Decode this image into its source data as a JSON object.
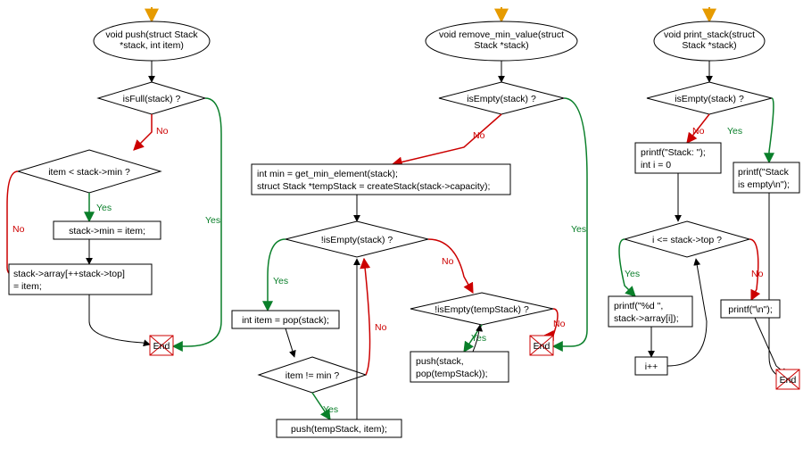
{
  "chart_data": {
    "type": "flowchart",
    "functions": [
      {
        "name": "push",
        "signature": "void push(struct Stack *stack, int item)"
      },
      {
        "name": "remove_min_value",
        "signature": "void remove_min_value(struct Stack *stack)"
      },
      {
        "name": "print_stack",
        "signature": "void print_stack(struct Stack *stack)"
      }
    ]
  },
  "labels": {
    "yes": "Yes",
    "no": "No",
    "end": "End"
  },
  "f1": {
    "sig1": "void push(struct Stack",
    "sig2": "*stack, int item)",
    "d1": "isFull(stack) ?",
    "d2": "item < stack->min ?",
    "a1": "stack->min = item;",
    "a2a": "stack->array[++stack->top]",
    "a2b": "= item;"
  },
  "f2": {
    "sig1": "void remove_min_value(struct",
    "sig2": "Stack *stack)",
    "d1": "isEmpty(stack) ?",
    "a1a": "int min = get_min_element(stack);",
    "a1b": "struct Stack *tempStack = createStack(stack->capacity);",
    "d2": "!isEmpty(stack) ?",
    "a2": "int item = pop(stack);",
    "d3": "item != min ?",
    "a3": "push(tempStack, item);",
    "d4": "!isEmpty(tempStack) ?",
    "a4a": "push(stack,",
    "a4b": "pop(tempStack));"
  },
  "f3": {
    "sig1": "void print_stack(struct",
    "sig2": "Stack *stack)",
    "d1": "isEmpty(stack) ?",
    "a1a": "printf(\"Stack: \");",
    "a1b": "int i = 0",
    "a2a": "printf(\"Stack",
    "a2b": "is empty\\n\");",
    "d2": "i <= stack->top ?",
    "a3a": "printf(\"%d \",",
    "a3b": "stack->array[i]);",
    "a4": "printf(\"\\n\");",
    "a5": "i++"
  }
}
